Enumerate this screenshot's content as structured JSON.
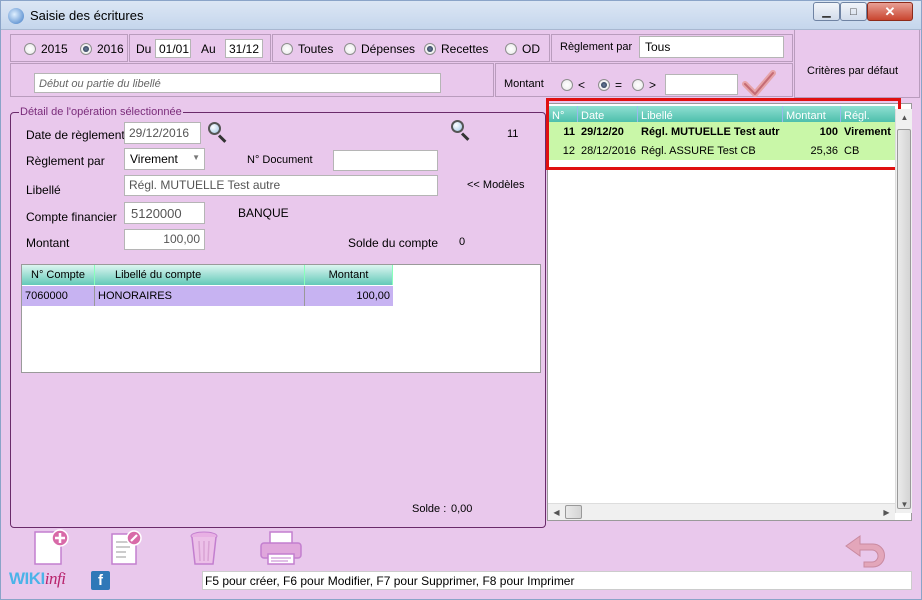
{
  "window": {
    "title": "Saisie des écritures"
  },
  "filters": {
    "years": [
      {
        "label": "2015",
        "selected": false
      },
      {
        "label": "2016",
        "selected": true
      }
    ],
    "du_label": "Du",
    "du_value": "01/01",
    "au_label": "Au",
    "au_value": "31/12",
    "types": [
      {
        "label": "Toutes",
        "selected": false
      },
      {
        "label": "Dépenses",
        "selected": false
      },
      {
        "label": "Recettes",
        "selected": true
      },
      {
        "label": "OD",
        "selected": false
      }
    ],
    "reglement_label": "Règlement par",
    "reglement_value": "Tous",
    "libelle_placeholder": "Début ou partie du libellé",
    "montant_label": "Montant",
    "montant_ops": [
      {
        "label": "<",
        "selected": false
      },
      {
        "label": "=",
        "selected": true
      },
      {
        "label": ">",
        "selected": false
      }
    ],
    "montant_value": "",
    "criteres_label": "Critères par défaut"
  },
  "detail": {
    "group_title": "Détail de l'opération sélectionnée",
    "date_label": "Date de règlement",
    "date_value": "29/12/2016",
    "number": "11",
    "reglement_label": "Règlement par",
    "reglement_value": "Virement",
    "document_label": "N° Document",
    "document_value": "",
    "libelle_label": "Libellé",
    "libelle_value": "Régl. MUTUELLE Test autre",
    "modeles_label": "<< Modèles",
    "compte_label": "Compte financier",
    "compte_value": "5120000",
    "compte_name": "BANQUE",
    "montant_label": "Montant",
    "montant_value": "100,00",
    "solde_compte_label": "Solde du compte",
    "solde_compte_value": "0",
    "lines_headers": [
      "N° Compte",
      "Libellé du compte",
      "Montant"
    ],
    "lines": [
      {
        "compte": "7060000",
        "libelle": "HONORAIRES",
        "montant": "100,00"
      }
    ],
    "solde_label": "Solde :",
    "solde_value": "0,00"
  },
  "list": {
    "headers": [
      "N°",
      "Date",
      "Libellé",
      "Montant",
      "Régl."
    ],
    "rows": [
      {
        "n": "11",
        "date": "29/12/20",
        "libelle": "Régl. MUTUELLE Test autr",
        "montant": "100",
        "regl": "Virement"
      },
      {
        "n": "12",
        "date": "28/12/2016",
        "libelle": "Régl. ASSURE Test CB",
        "montant": "25,36",
        "regl": "CB"
      }
    ]
  },
  "footer": {
    "brand_a": "WIKI",
    "brand_b": "infi",
    "status_text": "F5 pour créer, F6 pour Modifier, F7 pour Supprimer, F8 pour Imprimer"
  },
  "colors": {
    "background": "#e9c8ec",
    "header_teal": "#63c9b8",
    "selected_row": "#c9f7a8",
    "line_row": "#c7b3f2",
    "highlight": "#e01010"
  }
}
